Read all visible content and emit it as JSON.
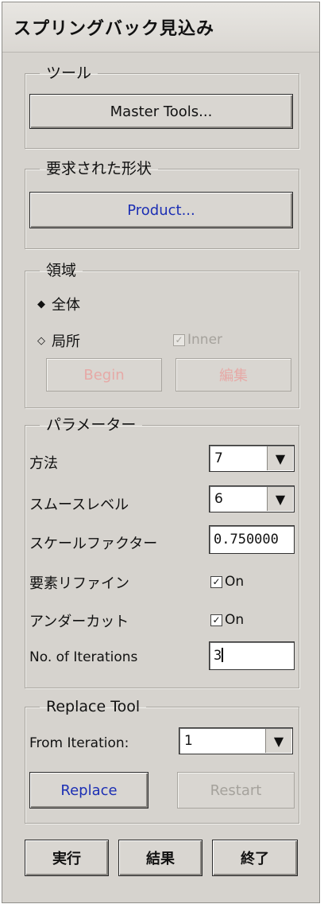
{
  "window": {
    "title": "スプリングバック見込み"
  },
  "tools": {
    "legend": "ツール",
    "master_button": "Master Tools..."
  },
  "shape": {
    "legend": "要求された形状",
    "product_button": "Product..."
  },
  "region": {
    "legend": "領域",
    "all_label": "全体",
    "local_label": "局所",
    "inner_label": "Inner",
    "inner_mark": "✓",
    "begin_button": "Begin",
    "edit_button": "編集",
    "selected": "all"
  },
  "params": {
    "legend": "パラメーター",
    "method_label": "方法",
    "method_value": "7",
    "smooth_label": "スムースレベル",
    "smooth_value": "6",
    "scale_label": "スケールファクター",
    "scale_value": "0.750000",
    "refine_label": "要素リファイン",
    "refine_on": "On",
    "refine_mark": "✓",
    "undercut_label": "アンダーカット",
    "undercut_on": "On",
    "undercut_mark": "✓",
    "iter_label": "No. of Iterations",
    "iter_value": "3"
  },
  "replace": {
    "legend": "Replace Tool",
    "from_label": "From Iteration:",
    "from_value": "1",
    "replace_button": "Replace",
    "restart_button": "Restart"
  },
  "footer": {
    "run_button": "実行",
    "result_button": "結果",
    "exit_button": "終了"
  },
  "icons": {
    "radio_selected": "◆",
    "radio_unselected": "◇",
    "dropdown": "▼"
  },
  "colors": {
    "panel": "#d6d3ce",
    "link_blue": "#1c2fb4",
    "disabled_red": "#e6a9a6"
  }
}
